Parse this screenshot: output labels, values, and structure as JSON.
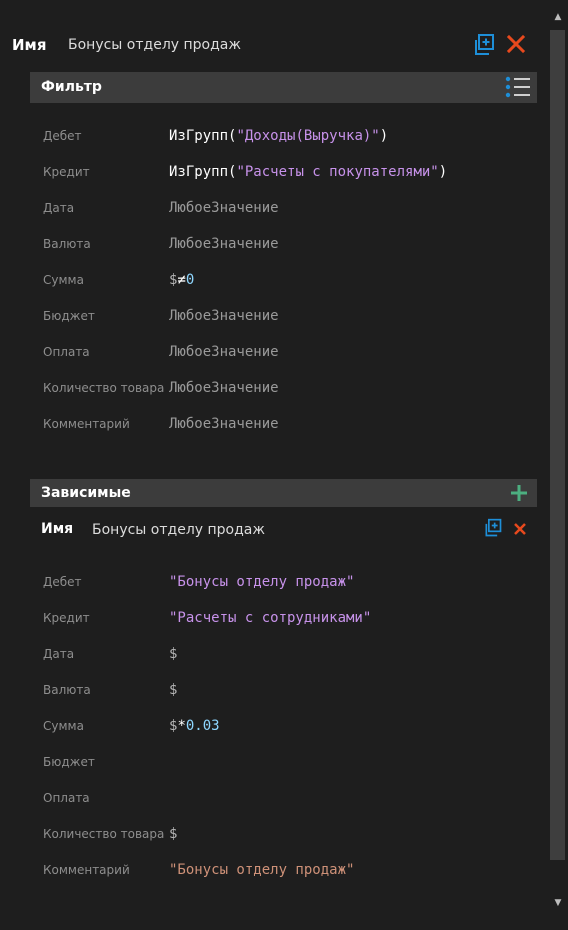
{
  "header": {
    "name_label": "Имя",
    "name_value": "Бонусы отделу продаж"
  },
  "filter": {
    "title": "Фильтр",
    "rows": [
      {
        "label": "Дебет",
        "fn": "ИзГрупп(",
        "str": "\"Доходы(Выручка)\"",
        "close": ")"
      },
      {
        "label": "Кредит",
        "fn": "ИзГрупп(",
        "str": "\"Расчеты с покупателями\"",
        "close": ")"
      },
      {
        "label": "Дата",
        "value": "ЛюбоеЗначение"
      },
      {
        "label": "Валюта",
        "value": "ЛюбоеЗначение"
      },
      {
        "label": "Сумма",
        "dollar": "$",
        "op": "≠",
        "num": "0"
      },
      {
        "label": "Бюджет",
        "value": "ЛюбоеЗначение"
      },
      {
        "label": "Оплата",
        "value": "ЛюбоеЗначение"
      },
      {
        "label": "Количество товара",
        "value": "ЛюбоеЗначение"
      },
      {
        "label": "Комментарий",
        "value": "ЛюбоеЗначение"
      }
    ]
  },
  "dependents": {
    "title": "Зависимые",
    "item": {
      "name_label": "Имя",
      "name_value": "Бонусы отделу продаж",
      "rows": [
        {
          "label": "Дебет",
          "str": "\"Бонусы отделу продаж\""
        },
        {
          "label": "Кредит",
          "str": "\"Расчеты с сотрудниками\""
        },
        {
          "label": "Дата",
          "dollar": "$"
        },
        {
          "label": "Валюта",
          "dollar": "$"
        },
        {
          "label": "Сумма",
          "dollar": "$",
          "op": "*",
          "num": "0.03"
        },
        {
          "label": "Бюджет"
        },
        {
          "label": "Оплата"
        },
        {
          "label": "Количество товара",
          "dollar": "$"
        },
        {
          "label": "Комментарий",
          "str2": "\"Бонусы отделу продаж\""
        }
      ]
    }
  },
  "colors": {
    "accent_blue": "#1e8fd8",
    "close_red": "#e8491d",
    "add_green": "#4caf80"
  }
}
